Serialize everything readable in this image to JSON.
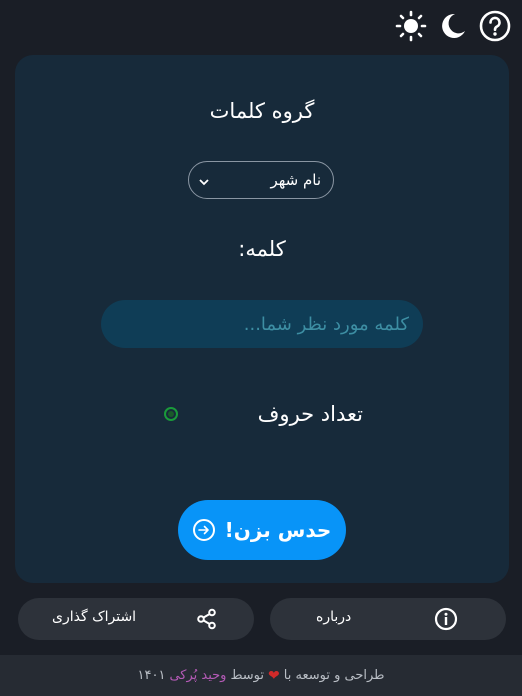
{
  "topbar": {
    "icons": [
      "help-icon",
      "moon-icon",
      "sun-icon"
    ]
  },
  "card": {
    "title": "گروه کلمات",
    "category_select": {
      "selected": "نام شهر"
    },
    "word_label": "کلمه:",
    "word_input": {
      "placeholder": "کلمه مورد نظر شما...",
      "value": ""
    },
    "letter_count": {
      "label": "تعداد حروف"
    },
    "guess_button": {
      "label": "حدس بزن!",
      "icon": "arrow-right-circle-icon"
    }
  },
  "bottom": {
    "share_label": "اشتراک گذاری",
    "about_label": "درباره"
  },
  "footer": {
    "prefix": "طراحی و توسعه با",
    "middle": "توسط",
    "author": "وحید پُرکی",
    "year": "۱۴۰۱"
  },
  "colors": {
    "background": "#1a1e26",
    "card": "#172a3a",
    "input": "#0f3d56",
    "primary": "#0894f8",
    "radio": "#1a9a3a",
    "heart": "#d02a2a",
    "author": "#b45ab6"
  }
}
